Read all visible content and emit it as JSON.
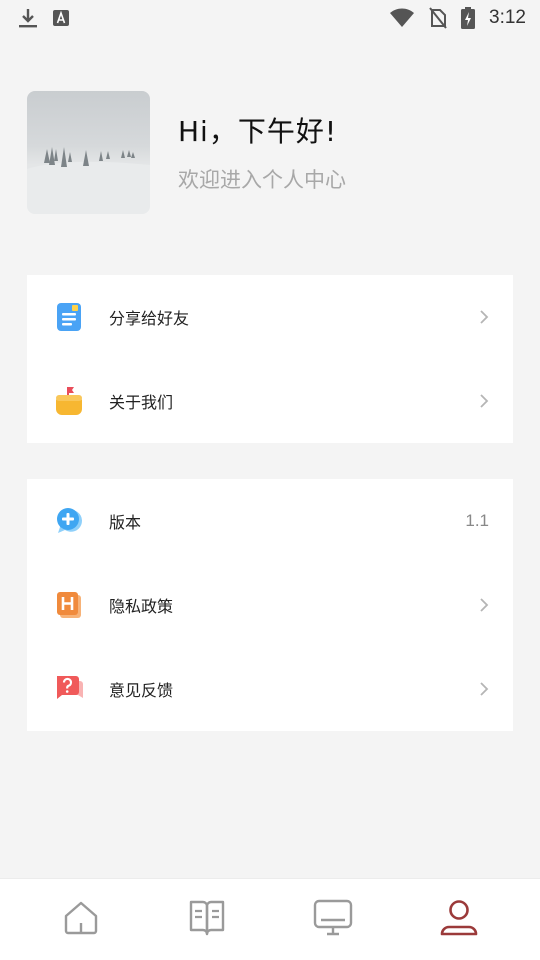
{
  "status_bar": {
    "time": "3:12",
    "left_icons": [
      "download-icon",
      "text-a-icon"
    ],
    "right_icons": [
      "wifi-icon",
      "no-sim-icon",
      "battery-charging-icon"
    ]
  },
  "profile": {
    "greeting": "Hi，下午好!",
    "subtitle": "欢迎进入个人中心",
    "avatar": "snowy-trees-avatar"
  },
  "menu_group_1": [
    {
      "label": "分享给好友",
      "icon": "share-doc-icon",
      "accent": "#4aa3f5"
    },
    {
      "label": "关于我们",
      "icon": "about-flag-icon",
      "accent": "#f7b731"
    }
  ],
  "menu_group_2": [
    {
      "label": "版本",
      "icon": "version-chat-icon",
      "accent": "#3fa6f2",
      "value": "1.1"
    },
    {
      "label": "隐私政策",
      "icon": "privacy-h-icon",
      "accent": "#f08a3c"
    },
    {
      "label": "意见反馈",
      "icon": "feedback-question-icon",
      "accent": "#f05a5a"
    }
  ],
  "bottom_nav": [
    {
      "name": "home",
      "icon": "home-icon",
      "active": false
    },
    {
      "name": "book",
      "icon": "book-icon",
      "active": false
    },
    {
      "name": "screen",
      "icon": "monitor-icon",
      "active": false
    },
    {
      "name": "profile",
      "icon": "user-icon",
      "active": true
    }
  ],
  "colors": {
    "active_tab": "#9b3a3a",
    "inactive_tab": "#9a9a9a",
    "background": "#f4f4f4"
  }
}
